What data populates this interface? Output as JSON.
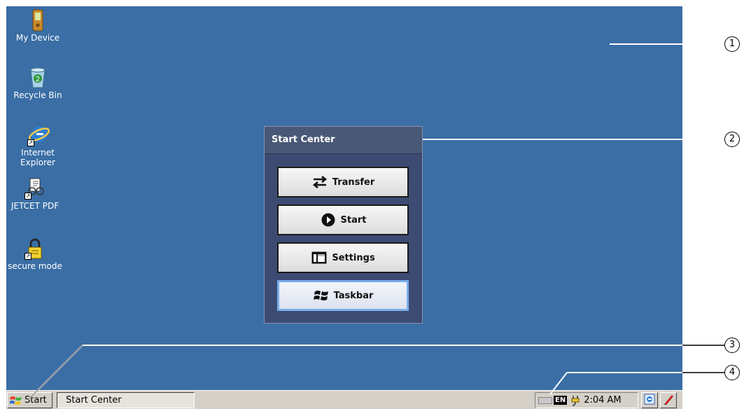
{
  "desktop": {
    "background_color": "#3a6ea5",
    "icons": [
      {
        "label": "My Device",
        "icon": "pda-icon"
      },
      {
        "label": "Recycle Bin",
        "icon": "recycle-bin-icon"
      },
      {
        "label": "Internet Explorer",
        "icon": "internet-explorer-icon"
      },
      {
        "label": "JETCET PDF",
        "icon": "pdf-viewer-icon"
      },
      {
        "label": "secure mode",
        "icon": "lock-icon"
      }
    ]
  },
  "start_center": {
    "title": "Start Center",
    "buttons": [
      {
        "label": "Transfer",
        "icon": "transfer-arrows-icon"
      },
      {
        "label": "Start",
        "icon": "play-icon"
      },
      {
        "label": "Settings",
        "icon": "settings-panel-icon"
      },
      {
        "label": "Taskbar",
        "icon": "windows-flag-icon",
        "selected": true
      }
    ]
  },
  "taskbar": {
    "start_label": "Start",
    "tasks": [
      {
        "label": "Start Center"
      }
    ],
    "tray": {
      "language": "EN",
      "time": "2:04 AM"
    }
  },
  "callouts": [
    "1",
    "2",
    "3",
    "4"
  ]
}
